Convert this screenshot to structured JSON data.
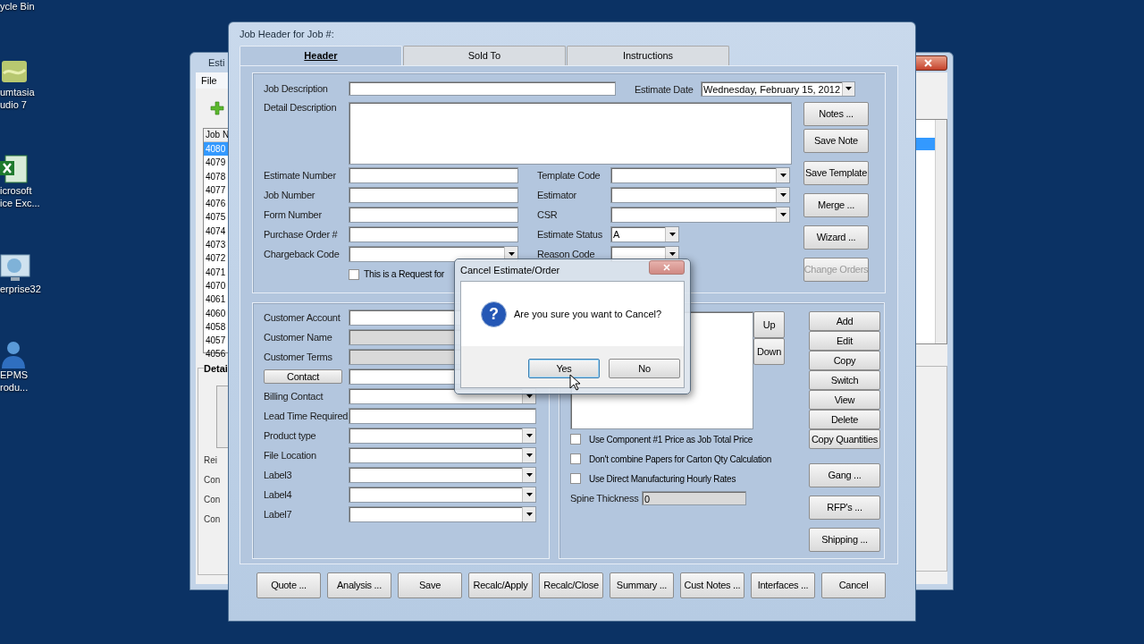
{
  "desktop_icons": [
    {
      "kind": "none",
      "lines": [
        "ycle Bin"
      ]
    },
    {
      "kind": "camtasia",
      "lines": [
        "umtasia",
        "udio 7"
      ]
    },
    {
      "kind": "spreadsheet",
      "lines": [
        "icrosoft",
        "ice Exc..."
      ]
    },
    {
      "kind": "monitor",
      "lines": [
        "erprise32"
      ]
    },
    {
      "kind": "person",
      "lines": [
        "EPMS",
        "rodu..."
      ]
    }
  ],
  "back_window": {
    "title": "Esti",
    "menu": [
      "File"
    ],
    "list": {
      "header": "Job N",
      "rows": [
        {
          "text": "4080",
          "selected": true
        },
        {
          "text": "4079",
          "selected": false
        },
        {
          "text": "4078",
          "selected": false
        },
        {
          "text": "4077",
          "selected": false
        },
        {
          "text": "4076",
          "selected": false
        },
        {
          "text": "4075",
          "selected": false
        },
        {
          "text": "4074",
          "selected": false
        },
        {
          "text": "4073",
          "selected": false
        },
        {
          "text": "4072",
          "selected": false
        },
        {
          "text": "4071",
          "selected": false
        },
        {
          "text": "4070",
          "selected": false
        },
        {
          "text": "4061",
          "selected": false
        },
        {
          "text": "4060",
          "selected": false
        },
        {
          "text": "4058",
          "selected": false
        },
        {
          "text": "4057",
          "selected": false
        },
        {
          "text": "4056",
          "selected": false
        }
      ]
    },
    "group": {
      "title": "Detai",
      "labels": [
        "Rei",
        "Con",
        "Con",
        "Con"
      ]
    }
  },
  "window": {
    "title": "Job Header for Job #:",
    "tabs": [
      {
        "label": "Header",
        "selected": true
      },
      {
        "label": "Sold To",
        "selected": false
      },
      {
        "label": "Instructions",
        "selected": false
      }
    ],
    "top": {
      "job_description": {
        "label": "Job Description"
      },
      "estimate_date": {
        "label": "Estimate Date",
        "value": "Wednesday,  February  15, 2012"
      },
      "detail_description": {
        "label": "Detail Description"
      },
      "left_fields": [
        {
          "label": "Estimate Number",
          "kind": "text"
        },
        {
          "label": "Job Number",
          "kind": "text"
        },
        {
          "label": "Form Number",
          "kind": "text"
        },
        {
          "label": "Purchase Order #",
          "kind": "text"
        },
        {
          "label": "Chargeback Code",
          "kind": "combo"
        }
      ],
      "right_fields": [
        {
          "label": "Template Code",
          "kind": "combo"
        },
        {
          "label": "Estimator",
          "kind": "combo"
        },
        {
          "label": "CSR",
          "kind": "combo"
        },
        {
          "label": "Estimate Status",
          "kind": "small_combo",
          "value": "A"
        },
        {
          "label": "Reason Code",
          "kind": "small_combo"
        }
      ],
      "request_checkbox": {
        "label": "This is a Request for",
        "checked": false
      },
      "buttons": [
        {
          "label": "Notes ...",
          "disabled": false
        },
        {
          "label": "Save Note",
          "disabled": false
        },
        {
          "label": "Save Template",
          "disabled": false
        },
        {
          "label": "Merge ...",
          "disabled": false
        },
        {
          "label": "Wizard ...",
          "disabled": false
        },
        {
          "label": "Change Orders",
          "disabled": true
        }
      ]
    },
    "customer": {
      "fields": [
        {
          "label": "Customer Account",
          "kind": "text"
        },
        {
          "label": "Customer Name",
          "kind": "readonly"
        },
        {
          "label": "Customer Terms",
          "kind": "readonly"
        },
        {
          "label": "Contact",
          "kind": "button"
        },
        {
          "label": "Billing Contact",
          "kind": "combo"
        },
        {
          "label": "Lead Time Required",
          "kind": "text"
        },
        {
          "label": "Product type",
          "kind": "combo"
        },
        {
          "label": "File Location",
          "kind": "combo"
        },
        {
          "label": "Label3",
          "kind": "combo"
        },
        {
          "label": "Label4",
          "kind": "combo"
        },
        {
          "label": "Label7",
          "kind": "combo"
        }
      ]
    },
    "components": {
      "move_buttons": [
        "Up",
        "Down"
      ],
      "buttons": [
        "Add",
        "Edit",
        "Copy",
        "Switch",
        "View",
        "Delete",
        "Copy Quantities"
      ],
      "options": [
        {
          "label": "Use Component #1 Price as Job Total Price",
          "checked": false
        },
        {
          "label": "Don't combine Papers for Carton Qty Calculation",
          "checked": false
        },
        {
          "label": "Use Direct Manufacturing Hourly Rates",
          "checked": false
        }
      ],
      "spine_thickness": {
        "label": "Spine Thickness",
        "value": "0"
      },
      "side_buttons": [
        "Gang ...",
        "RFP's ...",
        "Shipping ..."
      ]
    },
    "footer_buttons": [
      "Quote ...",
      "Analysis ...",
      "Save",
      "Recalc/Apply",
      "Recalc/Close",
      "Summary ...",
      "Cust Notes ...",
      "Interfaces ...",
      "Cancel"
    ]
  },
  "dialog": {
    "title": "Cancel Estimate/Order",
    "icon_text": "?",
    "message": "Are you sure you want to Cancel?",
    "buttons": [
      {
        "label": "Yes",
        "selected": true
      },
      {
        "label": "No",
        "selected": false
      }
    ]
  }
}
